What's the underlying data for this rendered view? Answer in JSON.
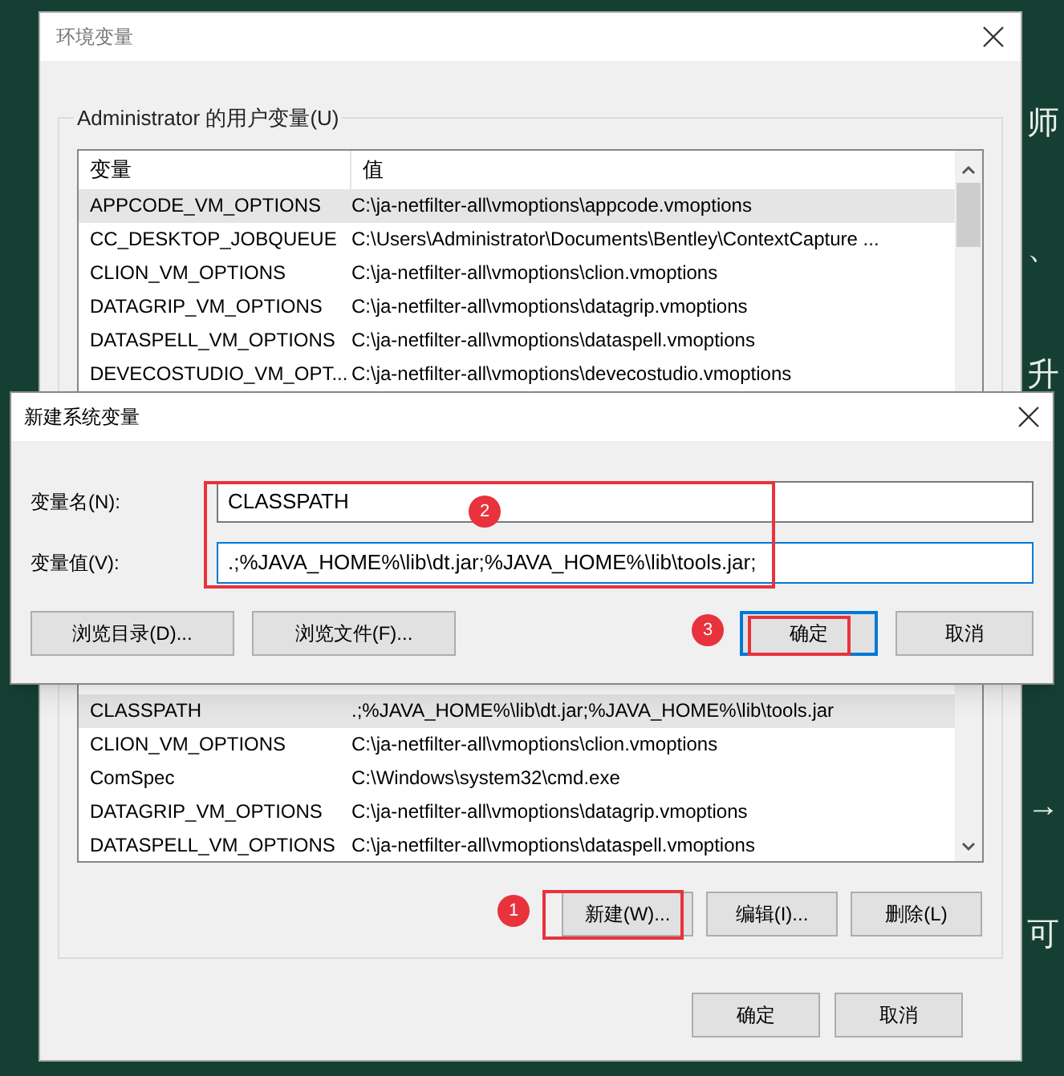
{
  "background_text": [
    "师",
    "、",
    "升",
    "→",
    "可"
  ],
  "env_window": {
    "title": "环境变量",
    "user_vars": {
      "label": "Administrator 的用户变量(U)",
      "columns": [
        "变量",
        "值"
      ],
      "rows": [
        {
          "name": "APPCODE_VM_OPTIONS",
          "value": "C:\\ja-netfilter-all\\vmoptions\\appcode.vmoptions",
          "selected": true
        },
        {
          "name": "CC_DESKTOP_JOBQUEUE",
          "value": "C:\\Users\\Administrator\\Documents\\Bentley\\ContextCapture ...",
          "selected": false
        },
        {
          "name": "CLION_VM_OPTIONS",
          "value": "C:\\ja-netfilter-all\\vmoptions\\clion.vmoptions",
          "selected": false
        },
        {
          "name": "DATAGRIP_VM_OPTIONS",
          "value": "C:\\ja-netfilter-all\\vmoptions\\datagrip.vmoptions",
          "selected": false
        },
        {
          "name": "DATASPELL_VM_OPTIONS",
          "value": "C:\\ja-netfilter-all\\vmoptions\\dataspell.vmoptions",
          "selected": false
        },
        {
          "name": "DEVECOSTUDIO_VM_OPT...",
          "value": "C:\\ja-netfilter-all\\vmoptions\\devecostudio.vmoptions",
          "selected": false
        }
      ]
    },
    "system_vars": {
      "rows": [
        {
          "name": "CLASSPATH",
          "value": ".;%JAVA_HOME%\\lib\\dt.jar;%JAVA_HOME%\\lib\\tools.jar",
          "selected": true
        },
        {
          "name": "CLION_VM_OPTIONS",
          "value": "C:\\ja-netfilter-all\\vmoptions\\clion.vmoptions",
          "selected": false
        },
        {
          "name": "ComSpec",
          "value": "C:\\Windows\\system32\\cmd.exe",
          "selected": false
        },
        {
          "name": "DATAGRIP_VM_OPTIONS",
          "value": "C:\\ja-netfilter-all\\vmoptions\\datagrip.vmoptions",
          "selected": false
        },
        {
          "name": "DATASPELL_VM_OPTIONS",
          "value": "C:\\ja-netfilter-all\\vmoptions\\dataspell.vmoptions",
          "selected": false
        }
      ],
      "buttons": [
        "新建(W)...",
        "编辑(I)...",
        "删除(L)"
      ]
    },
    "buttons": [
      "确定",
      "取消"
    ]
  },
  "new_dialog": {
    "title": "新建系统变量",
    "fields": [
      {
        "label": "变量名(N):",
        "value": "CLASSPATH",
        "focused": false
      },
      {
        "label": "变量值(V):",
        "value": ".;%JAVA_HOME%\\lib\\dt.jar;%JAVA_HOME%\\lib\\tools.jar;",
        "focused": true
      }
    ],
    "buttons": [
      {
        "label": "浏览目录(D)...",
        "default": false
      },
      {
        "label": "浏览文件(F)...",
        "default": false
      },
      {
        "label": "确定",
        "default": true
      },
      {
        "label": "取消",
        "default": false
      }
    ]
  },
  "annotations": [
    {
      "number": "1"
    },
    {
      "number": "2"
    },
    {
      "number": "3"
    }
  ]
}
